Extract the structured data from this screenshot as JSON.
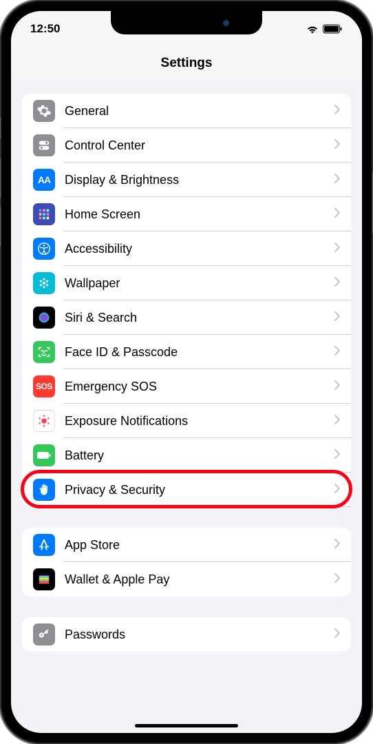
{
  "status": {
    "time": "12:50"
  },
  "header": {
    "title": "Settings"
  },
  "groups": [
    {
      "items": [
        {
          "id": "general",
          "label": "General"
        },
        {
          "id": "control-center",
          "label": "Control Center"
        },
        {
          "id": "display-brightness",
          "label": "Display & Brightness"
        },
        {
          "id": "home-screen",
          "label": "Home Screen"
        },
        {
          "id": "accessibility",
          "label": "Accessibility"
        },
        {
          "id": "wallpaper",
          "label": "Wallpaper"
        },
        {
          "id": "siri-search",
          "label": "Siri & Search"
        },
        {
          "id": "face-id-passcode",
          "label": "Face ID & Passcode"
        },
        {
          "id": "emergency-sos",
          "label": "Emergency SOS"
        },
        {
          "id": "exposure-notifications",
          "label": "Exposure Notifications"
        },
        {
          "id": "battery",
          "label": "Battery"
        },
        {
          "id": "privacy-security",
          "label": "Privacy & Security",
          "highlighted": true
        }
      ]
    },
    {
      "items": [
        {
          "id": "app-store",
          "label": "App Store"
        },
        {
          "id": "wallet-apple-pay",
          "label": "Wallet & Apple Pay"
        }
      ]
    },
    {
      "items": [
        {
          "id": "passwords",
          "label": "Passwords"
        }
      ]
    }
  ]
}
